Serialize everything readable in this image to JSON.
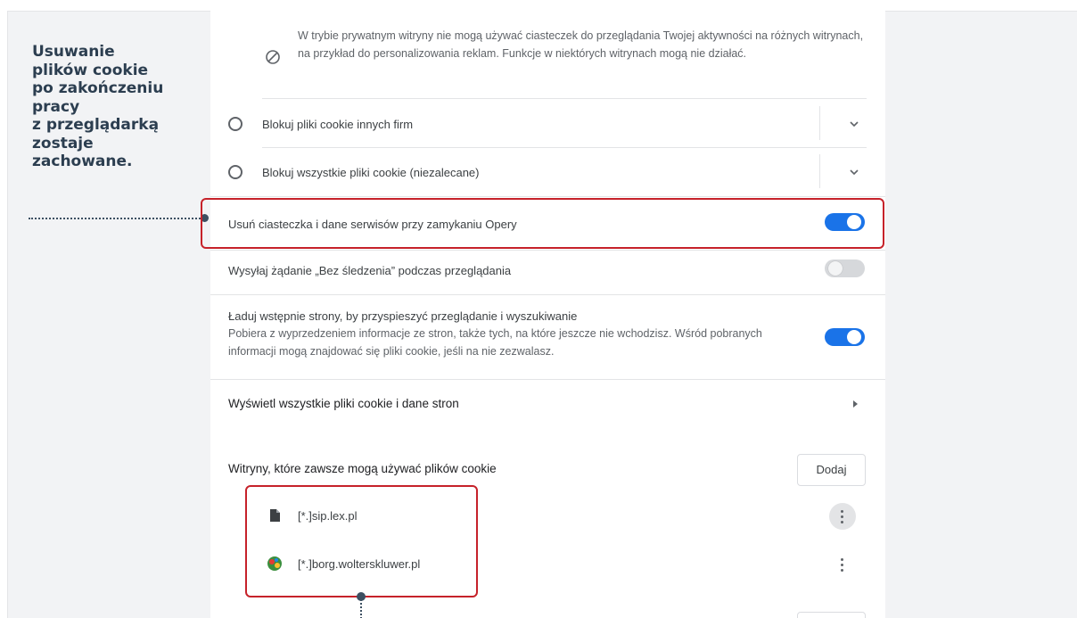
{
  "annotation": {
    "lines": [
      "Usuwanie",
      "plików cookie",
      "po zakończeniu",
      "pracy",
      "z przeglądarką",
      "zostaje",
      "zachowane."
    ]
  },
  "private_note": {
    "icon": "block-icon",
    "text": "W trybie prywatnym witryny nie mogą używać ciasteczek do przeglądania Twojej aktywności na różnych witrynach, na przykład do personalizowania reklam. Funkcje w niektórych witrynach mogą nie działać."
  },
  "radio_options": [
    {
      "label": "Blokuj pliki cookie innych firm",
      "selected": false
    },
    {
      "label": "Blokuj wszystkie pliki cookie (niezalecane)",
      "selected": false
    }
  ],
  "toggles": {
    "clear_on_exit": {
      "label": "Usuń ciasteczka i dane serwisów przy zamykaniu Opery",
      "on": true
    },
    "do_not_track": {
      "label": "Wysyłaj żądanie „Bez śledzenia” podczas przeglądania",
      "on": false
    },
    "preload": {
      "label": "Ładuj wstępnie strony, by przyspieszyć przeglądanie i wyszukiwanie",
      "description": "Pobiera z wyprzedzeniem informacje ze stron, także tych, na które jeszcze nie wchodzisz. Wśród pobranych informacji mogą znajdować się pliki cookie, jeśli na nie zezwalasz.",
      "on": true
    }
  },
  "view_all": {
    "label": "Wyświetl wszystkie pliki cookie i dane stron"
  },
  "allowed_sites": {
    "heading": "Witryny, które zawsze mogą używać plików cookie",
    "add_button": "Dodaj",
    "sites": [
      {
        "name": "[*.]sip.lex.pl",
        "icon": "file-icon"
      },
      {
        "name": "[*.]borg.wolterskluwer.pl",
        "icon": "globe-icon"
      }
    ]
  },
  "colors": {
    "accent": "#1a73e8",
    "highlight": "#c6222a",
    "annotation": "#2c3e50"
  }
}
